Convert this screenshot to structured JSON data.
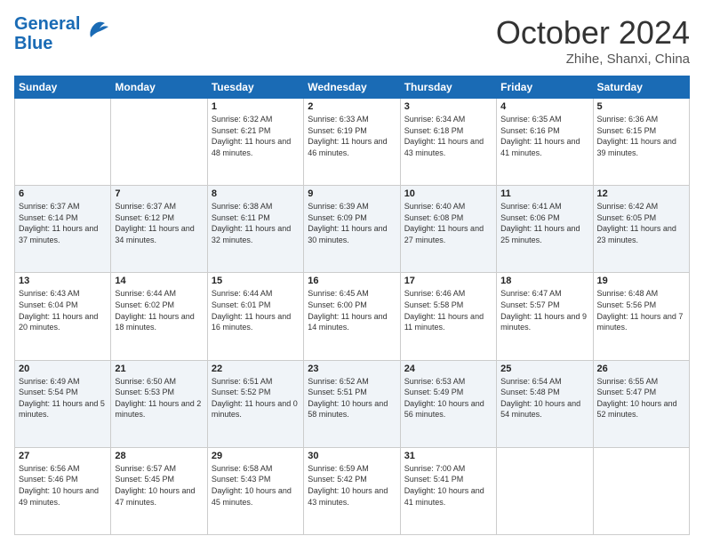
{
  "header": {
    "logo_line1": "General",
    "logo_line2": "Blue",
    "month": "October 2024",
    "location": "Zhihe, Shanxi, China"
  },
  "weekdays": [
    "Sunday",
    "Monday",
    "Tuesday",
    "Wednesday",
    "Thursday",
    "Friday",
    "Saturday"
  ],
  "weeks": [
    [
      {
        "day": "",
        "info": ""
      },
      {
        "day": "",
        "info": ""
      },
      {
        "day": "1",
        "info": "Sunrise: 6:32 AM\nSunset: 6:21 PM\nDaylight: 11 hours and 48 minutes."
      },
      {
        "day": "2",
        "info": "Sunrise: 6:33 AM\nSunset: 6:19 PM\nDaylight: 11 hours and 46 minutes."
      },
      {
        "day": "3",
        "info": "Sunrise: 6:34 AM\nSunset: 6:18 PM\nDaylight: 11 hours and 43 minutes."
      },
      {
        "day": "4",
        "info": "Sunrise: 6:35 AM\nSunset: 6:16 PM\nDaylight: 11 hours and 41 minutes."
      },
      {
        "day": "5",
        "info": "Sunrise: 6:36 AM\nSunset: 6:15 PM\nDaylight: 11 hours and 39 minutes."
      }
    ],
    [
      {
        "day": "6",
        "info": "Sunrise: 6:37 AM\nSunset: 6:14 PM\nDaylight: 11 hours and 37 minutes."
      },
      {
        "day": "7",
        "info": "Sunrise: 6:37 AM\nSunset: 6:12 PM\nDaylight: 11 hours and 34 minutes."
      },
      {
        "day": "8",
        "info": "Sunrise: 6:38 AM\nSunset: 6:11 PM\nDaylight: 11 hours and 32 minutes."
      },
      {
        "day": "9",
        "info": "Sunrise: 6:39 AM\nSunset: 6:09 PM\nDaylight: 11 hours and 30 minutes."
      },
      {
        "day": "10",
        "info": "Sunrise: 6:40 AM\nSunset: 6:08 PM\nDaylight: 11 hours and 27 minutes."
      },
      {
        "day": "11",
        "info": "Sunrise: 6:41 AM\nSunset: 6:06 PM\nDaylight: 11 hours and 25 minutes."
      },
      {
        "day": "12",
        "info": "Sunrise: 6:42 AM\nSunset: 6:05 PM\nDaylight: 11 hours and 23 minutes."
      }
    ],
    [
      {
        "day": "13",
        "info": "Sunrise: 6:43 AM\nSunset: 6:04 PM\nDaylight: 11 hours and 20 minutes."
      },
      {
        "day": "14",
        "info": "Sunrise: 6:44 AM\nSunset: 6:02 PM\nDaylight: 11 hours and 18 minutes."
      },
      {
        "day": "15",
        "info": "Sunrise: 6:44 AM\nSunset: 6:01 PM\nDaylight: 11 hours and 16 minutes."
      },
      {
        "day": "16",
        "info": "Sunrise: 6:45 AM\nSunset: 6:00 PM\nDaylight: 11 hours and 14 minutes."
      },
      {
        "day": "17",
        "info": "Sunrise: 6:46 AM\nSunset: 5:58 PM\nDaylight: 11 hours and 11 minutes."
      },
      {
        "day": "18",
        "info": "Sunrise: 6:47 AM\nSunset: 5:57 PM\nDaylight: 11 hours and 9 minutes."
      },
      {
        "day": "19",
        "info": "Sunrise: 6:48 AM\nSunset: 5:56 PM\nDaylight: 11 hours and 7 minutes."
      }
    ],
    [
      {
        "day": "20",
        "info": "Sunrise: 6:49 AM\nSunset: 5:54 PM\nDaylight: 11 hours and 5 minutes."
      },
      {
        "day": "21",
        "info": "Sunrise: 6:50 AM\nSunset: 5:53 PM\nDaylight: 11 hours and 2 minutes."
      },
      {
        "day": "22",
        "info": "Sunrise: 6:51 AM\nSunset: 5:52 PM\nDaylight: 11 hours and 0 minutes."
      },
      {
        "day": "23",
        "info": "Sunrise: 6:52 AM\nSunset: 5:51 PM\nDaylight: 10 hours and 58 minutes."
      },
      {
        "day": "24",
        "info": "Sunrise: 6:53 AM\nSunset: 5:49 PM\nDaylight: 10 hours and 56 minutes."
      },
      {
        "day": "25",
        "info": "Sunrise: 6:54 AM\nSunset: 5:48 PM\nDaylight: 10 hours and 54 minutes."
      },
      {
        "day": "26",
        "info": "Sunrise: 6:55 AM\nSunset: 5:47 PM\nDaylight: 10 hours and 52 minutes."
      }
    ],
    [
      {
        "day": "27",
        "info": "Sunrise: 6:56 AM\nSunset: 5:46 PM\nDaylight: 10 hours and 49 minutes."
      },
      {
        "day": "28",
        "info": "Sunrise: 6:57 AM\nSunset: 5:45 PM\nDaylight: 10 hours and 47 minutes."
      },
      {
        "day": "29",
        "info": "Sunrise: 6:58 AM\nSunset: 5:43 PM\nDaylight: 10 hours and 45 minutes."
      },
      {
        "day": "30",
        "info": "Sunrise: 6:59 AM\nSunset: 5:42 PM\nDaylight: 10 hours and 43 minutes."
      },
      {
        "day": "31",
        "info": "Sunrise: 7:00 AM\nSunset: 5:41 PM\nDaylight: 10 hours and 41 minutes."
      },
      {
        "day": "",
        "info": ""
      },
      {
        "day": "",
        "info": ""
      }
    ]
  ]
}
